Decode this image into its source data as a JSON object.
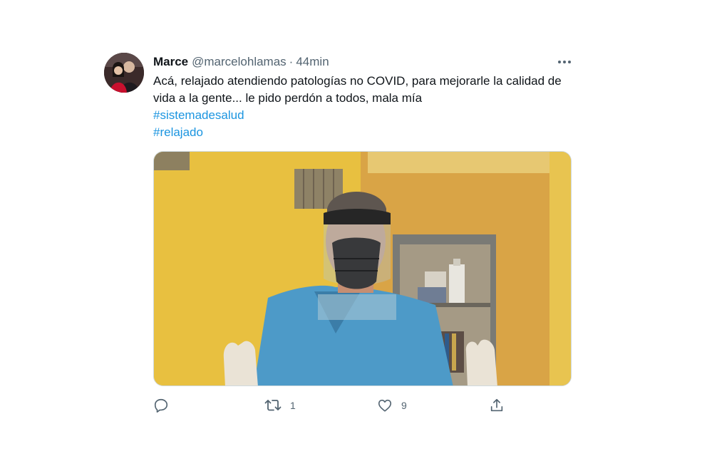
{
  "user": {
    "name": "Marce",
    "handle": "@marcelohlamas",
    "separator": "·",
    "time": "44min"
  },
  "tweet": {
    "text": "Acá, relajado atendiendo patologías no COVID, para mejorarle la calidad de vida a la gente... le pido perdón a todos, mala mía",
    "hashtags": [
      "#sistemadesalud",
      "#relajado"
    ]
  },
  "actions": {
    "reply_count": "",
    "retweet_count": "1",
    "like_count": "9"
  },
  "icons": {
    "more": "more-dots-icon",
    "reply": "reply-icon",
    "retweet": "retweet-icon",
    "like": "heart-icon",
    "share": "share-icon"
  },
  "colors": {
    "text": "#0f1419",
    "secondary": "#536471",
    "hashtag": "#1b95e0"
  }
}
